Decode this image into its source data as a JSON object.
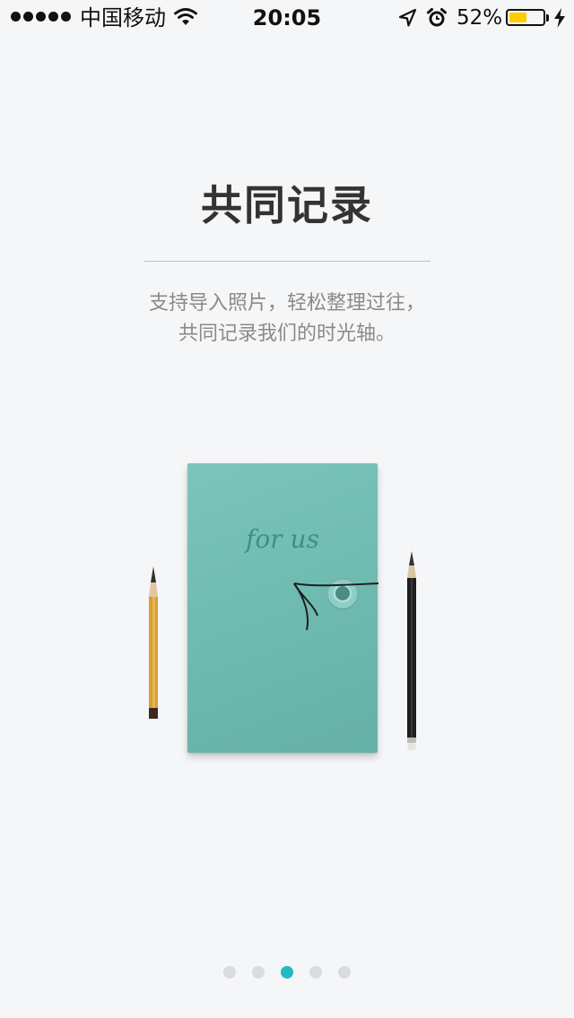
{
  "status_bar": {
    "carrier": "中国移动",
    "time": "20:05",
    "battery_percent": "52%",
    "battery_level": 0.52,
    "battery_color": "#ffcc00",
    "icons": [
      "signal-dots",
      "wifi-icon",
      "location-icon",
      "alarm-icon",
      "battery-icon",
      "charging-icon"
    ]
  },
  "onboarding": {
    "title": "共同记录",
    "subtitle_lines": [
      "支持导入照片，轻松整理过往，",
      "共同记录我们的时光轴。"
    ],
    "illustration": {
      "notebook_label": "for us",
      "notebook_color": "#6fbbb1"
    }
  },
  "pager": {
    "total": 5,
    "active_index": 2,
    "active_color": "#23b9c4",
    "inactive_color": "#dadbdd"
  }
}
